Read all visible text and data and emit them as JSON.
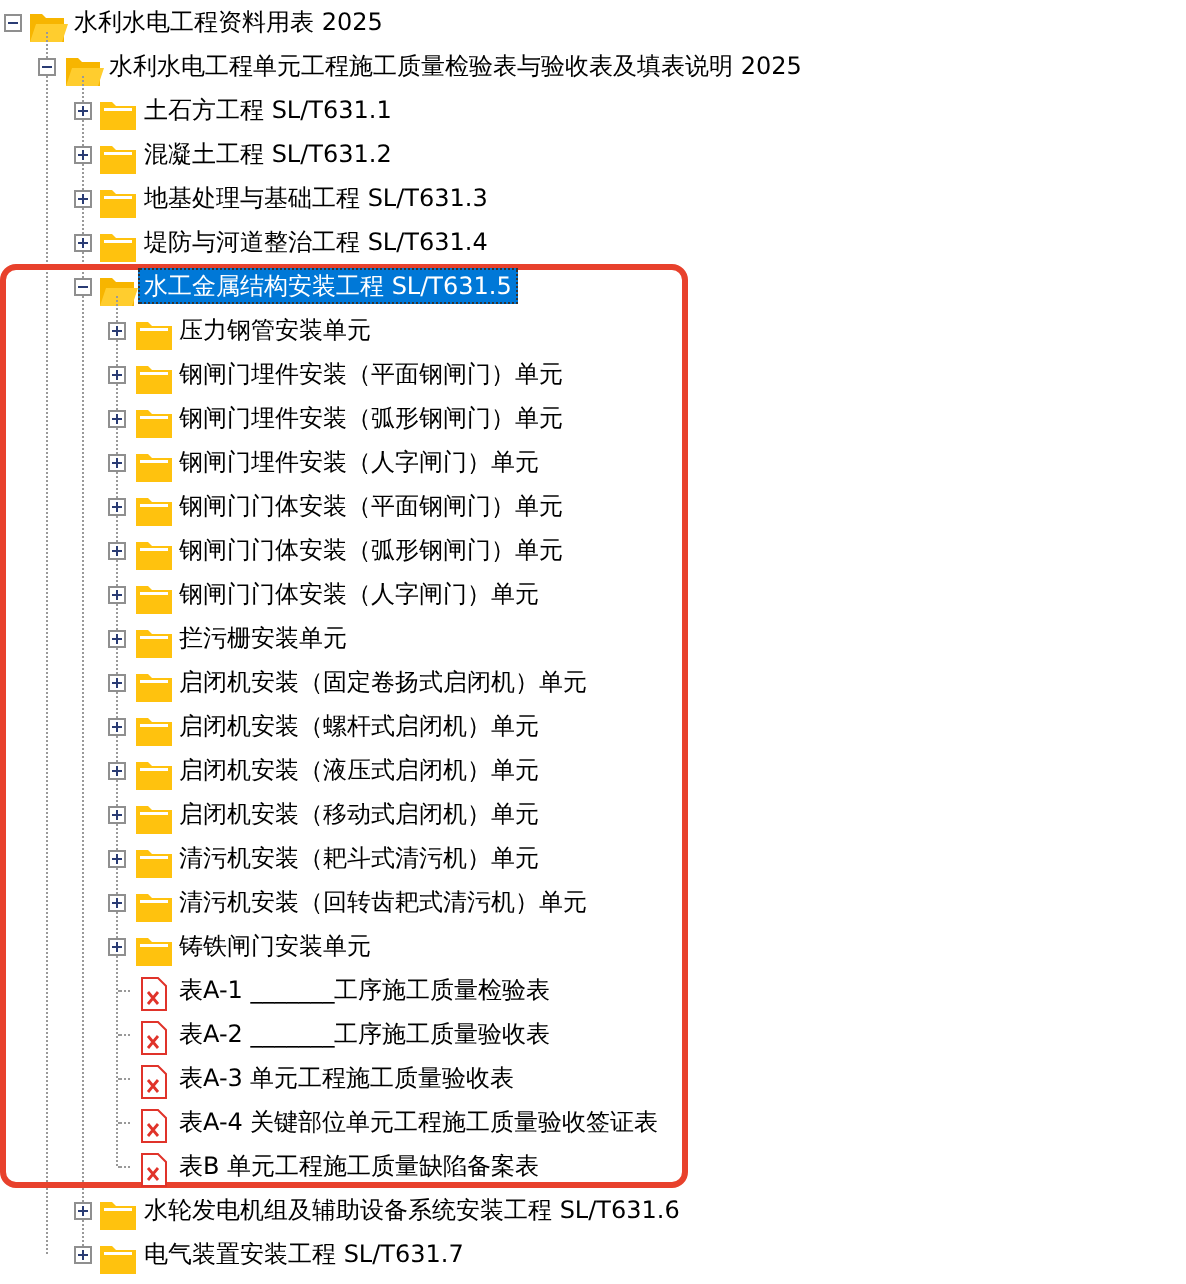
{
  "tree": [
    {
      "label": "水利水电工程资料用表 2025",
      "kind": "folder",
      "expanded": true,
      "selected": false,
      "children": [
        {
          "label": "水利水电工程单元工程施工质量检验表与验收表及填表说明 2025",
          "kind": "folder",
          "expanded": true,
          "selected": false,
          "children": [
            {
              "label": "土石方工程 SL/T631.1",
              "kind": "folder",
              "expanded": false,
              "selected": false
            },
            {
              "label": "混凝土工程 SL/T631.2",
              "kind": "folder",
              "expanded": false,
              "selected": false
            },
            {
              "label": "地基处理与基础工程 SL/T631.3",
              "kind": "folder",
              "expanded": false,
              "selected": false
            },
            {
              "label": "堤防与河道整治工程 SL/T631.4",
              "kind": "folder",
              "expanded": false,
              "selected": false
            },
            {
              "label": "水工金属结构安装工程 SL/T631.5",
              "kind": "folder",
              "expanded": true,
              "selected": true,
              "highlighted": true,
              "children": [
                {
                  "label": "压力钢管安装单元",
                  "kind": "folder",
                  "expanded": false,
                  "selected": false
                },
                {
                  "label": "钢闸门埋件安装（平面钢闸门）单元",
                  "kind": "folder",
                  "expanded": false,
                  "selected": false
                },
                {
                  "label": "钢闸门埋件安装（弧形钢闸门）单元",
                  "kind": "folder",
                  "expanded": false,
                  "selected": false
                },
                {
                  "label": "钢闸门埋件安装（人字闸门）单元",
                  "kind": "folder",
                  "expanded": false,
                  "selected": false
                },
                {
                  "label": "钢闸门门体安装（平面钢闸门）单元",
                  "kind": "folder",
                  "expanded": false,
                  "selected": false
                },
                {
                  "label": "钢闸门门体安装（弧形钢闸门）单元",
                  "kind": "folder",
                  "expanded": false,
                  "selected": false
                },
                {
                  "label": "钢闸门门体安装（人字闸门）单元",
                  "kind": "folder",
                  "expanded": false,
                  "selected": false
                },
                {
                  "label": "拦污栅安装单元",
                  "kind": "folder",
                  "expanded": false,
                  "selected": false
                },
                {
                  "label": "启闭机安装（固定卷扬式启闭机）单元",
                  "kind": "folder",
                  "expanded": false,
                  "selected": false
                },
                {
                  "label": "启闭机安装（螺杆式启闭机）单元",
                  "kind": "folder",
                  "expanded": false,
                  "selected": false
                },
                {
                  "label": "启闭机安装（液压式启闭机）单元",
                  "kind": "folder",
                  "expanded": false,
                  "selected": false
                },
                {
                  "label": "启闭机安装（移动式启闭机）单元",
                  "kind": "folder",
                  "expanded": false,
                  "selected": false
                },
                {
                  "label": "清污机安装（耙斗式清污机）单元",
                  "kind": "folder",
                  "expanded": false,
                  "selected": false
                },
                {
                  "label": "清污机安装（回转齿耙式清污机）单元",
                  "kind": "folder",
                  "expanded": false,
                  "selected": false
                },
                {
                  "label": "铸铁闸门安装单元",
                  "kind": "folder",
                  "expanded": false,
                  "selected": false
                },
                {
                  "label": "表A-1 _______工序施工质量检验表",
                  "kind": "file",
                  "selected": false
                },
                {
                  "label": "表A-2 _______工序施工质量验收表",
                  "kind": "file",
                  "selected": false
                },
                {
                  "label": "表A-3 单元工程施工质量验收表",
                  "kind": "file",
                  "selected": false
                },
                {
                  "label": "表A-4 关键部位单元工程施工质量验收签证表",
                  "kind": "file",
                  "selected": false
                },
                {
                  "label": "表B 单元工程施工质量缺陷备案表",
                  "kind": "file",
                  "selected": false
                }
              ]
            },
            {
              "label": "水轮发电机组及辅助设备系统安装工程 SL/T631.6",
              "kind": "folder",
              "expanded": false,
              "selected": false
            },
            {
              "label": "电气装置安装工程 SL/T631.7",
              "kind": "folder",
              "expanded": false,
              "selected": false
            }
          ]
        }
      ]
    }
  ]
}
